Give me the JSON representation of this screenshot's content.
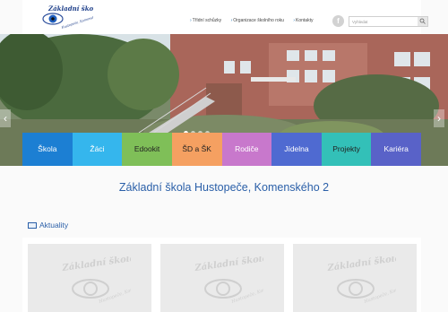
{
  "logo": {
    "line1": "Základní škola",
    "line2": "Hustopeče, Komenského 2"
  },
  "toplinks": [
    {
      "label": "Třídní schůzky"
    },
    {
      "label": "Organizace školního roku"
    },
    {
      "label": "Kontakty"
    }
  ],
  "facebook": {
    "glyph": "f"
  },
  "search": {
    "placeholder": "Vyhledat"
  },
  "hero": {
    "slide_count": 4,
    "active_slide": 1
  },
  "nav": [
    {
      "label": "Škola",
      "color": "#1c7fd3",
      "text_color": "#ffffff"
    },
    {
      "label": "Žáci",
      "color": "#35b6ed",
      "text_color": "#ffffff"
    },
    {
      "label": "Edookit",
      "color": "#7fbf58",
      "text_color": "#222222"
    },
    {
      "label": "ŠD a ŠK",
      "color": "#f5a061",
      "text_color": "#222222"
    },
    {
      "label": "Rodiče",
      "color": "#c878cc",
      "text_color": "#ffffff"
    },
    {
      "label": "Jídelna",
      "color": "#4f6ad1",
      "text_color": "#ffffff"
    },
    {
      "label": "Projekty",
      "color": "#33c0b8",
      "text_color": "#222222"
    },
    {
      "label": "Kariéra",
      "color": "#5962c8",
      "text_color": "#ffffff"
    }
  ],
  "headline": "Základní škola Hustopeče, Komenského 2",
  "news": {
    "title": "Aktuality"
  }
}
